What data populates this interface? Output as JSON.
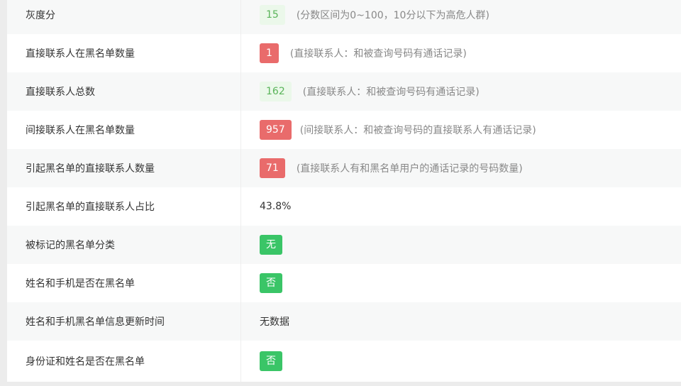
{
  "rows": [
    {
      "label": "灰度分",
      "value": "15",
      "note": "(分数区间为0~100，10分以下为高危人群)"
    },
    {
      "label": "直接联系人在黑名单数量",
      "value": "1",
      "note": "(直接联系人：和被查询号码有通话记录)"
    },
    {
      "label": "直接联系人总数",
      "value": "162",
      "note": "(直接联系人：和被查询号码有通话记录)"
    },
    {
      "label": "间接联系人在黑名单数量",
      "value": "957",
      "note": "(间接联系人：和被查询号码的直接联系人有通话记录)"
    },
    {
      "label": "引起黑名单的直接联系人数量",
      "value": "71",
      "note": "(直接联系人有和黑名单用户的通话记录的号码数量)"
    },
    {
      "label": "引起黑名单的直接联系人占比",
      "value": "43.8%"
    },
    {
      "label": "被标记的黑名单分类",
      "value": "无"
    },
    {
      "label": "姓名和手机是否在黑名单",
      "value": "否"
    },
    {
      "label": "姓名和手机黑名单信息更新时间",
      "value": "无数据"
    },
    {
      "label": "身份证和姓名是否在黑名单",
      "value": "否"
    }
  ],
  "colors": {
    "badge_light_bg": "#ebf8ea",
    "badge_light_text": "#5ab45a",
    "badge_danger": "#e96b6b",
    "badge_success": "#3ac567"
  }
}
